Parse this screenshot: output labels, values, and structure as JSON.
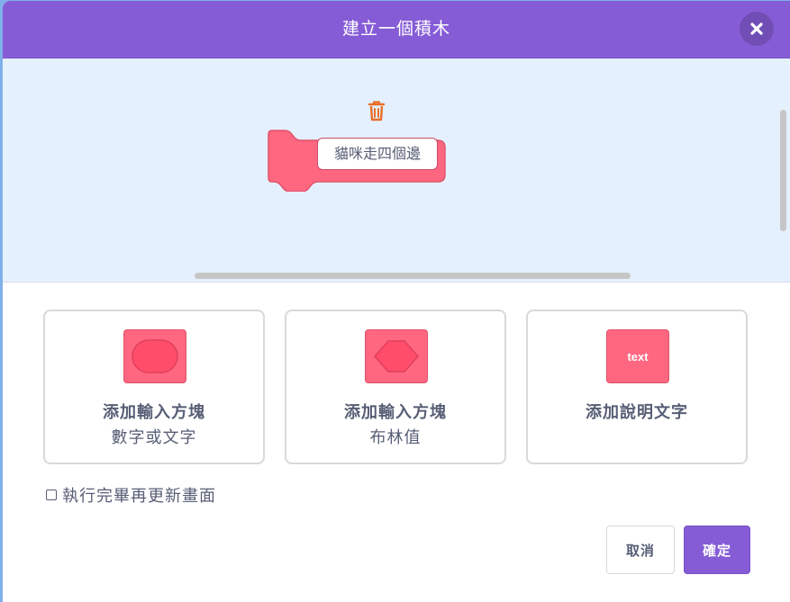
{
  "dialog": {
    "title": "建立一個積木",
    "close_icon": "close-x-icon"
  },
  "workspace": {
    "block_name": "貓咪走四個邊",
    "block_color": "#ff6680",
    "delete_icon": "trash-icon"
  },
  "options": [
    {
      "title": "添加輸入方塊",
      "subtitle": "數字或文字",
      "icon": "oval-input-icon"
    },
    {
      "title": "添加輸入方塊",
      "subtitle": "布林值",
      "icon": "hexagon-boolean-icon"
    },
    {
      "title": "添加說明文字",
      "subtitle": "",
      "icon": "text-label-icon",
      "icon_text": "text"
    }
  ],
  "run_without_refresh": {
    "label": "執行完畢再更新畫面",
    "checked": false
  },
  "buttons": {
    "cancel": "取消",
    "ok": "確定"
  },
  "colors": {
    "header": "#855cd6",
    "workspace_bg": "#e5f0ff",
    "block": "#ff6680",
    "text": "#575e75"
  }
}
